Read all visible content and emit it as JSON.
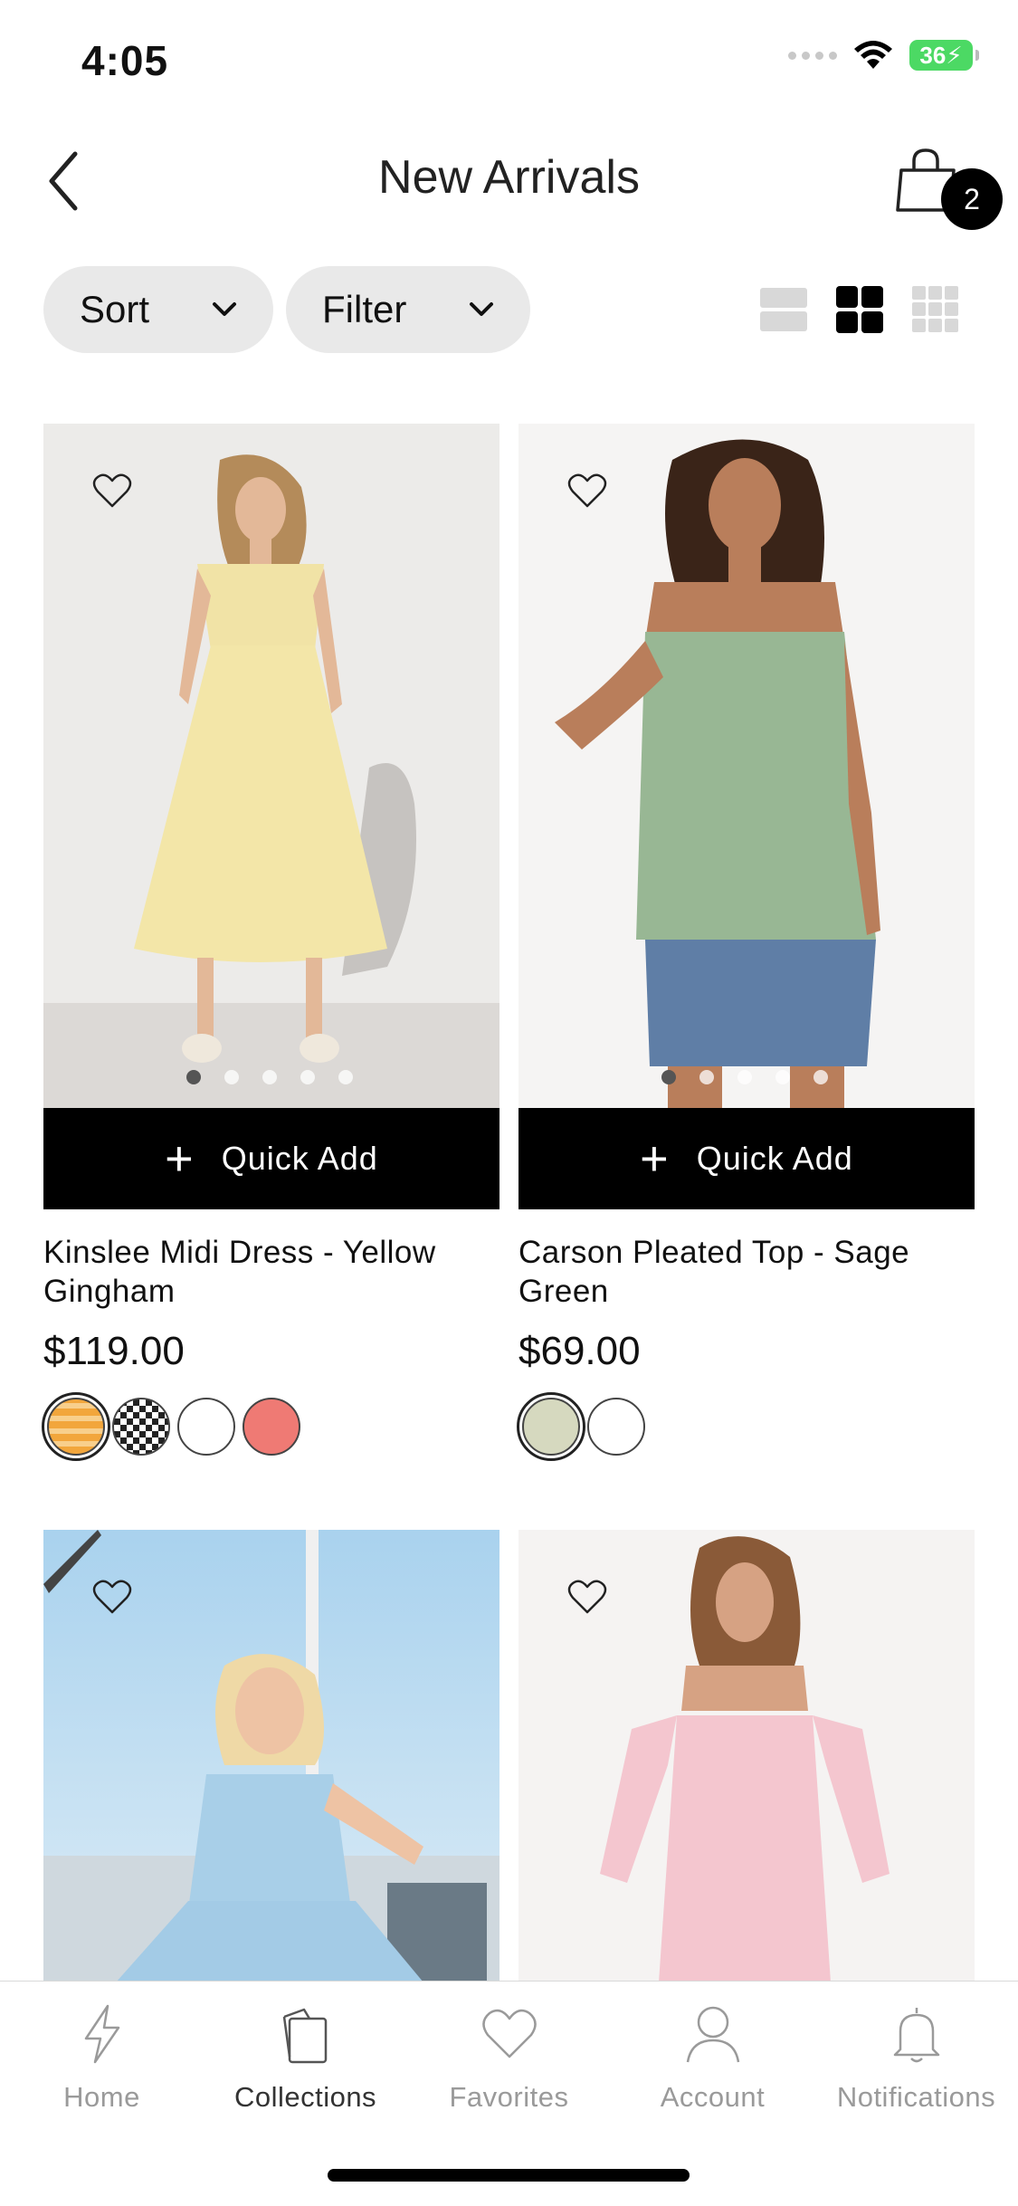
{
  "status_bar": {
    "time": "4:05",
    "battery": "36"
  },
  "header": {
    "title": "New Arrivals",
    "cart_count": "2"
  },
  "controls": {
    "sort_label": "Sort",
    "filter_label": "Filter"
  },
  "products": [
    {
      "name": "Kinslee Midi Dress - Yellow Gingham",
      "price": "$119.00",
      "quick_add": "Quick Add",
      "swatches": [
        "#f2a63c",
        "#222222",
        "#ffffff",
        "#ef7a74"
      ]
    },
    {
      "name": "Carson Pleated Top - Sage Green",
      "price": "$69.00",
      "quick_add": "Quick Add",
      "swatches": [
        "#d6d9bf",
        "#ffffff"
      ]
    }
  ],
  "tabs": [
    {
      "label": "Home",
      "icon": "bolt-icon"
    },
    {
      "label": "Collections",
      "icon": "collections-icon"
    },
    {
      "label": "Favorites",
      "icon": "heart-icon"
    },
    {
      "label": "Account",
      "icon": "person-icon"
    },
    {
      "label": "Notifications",
      "icon": "bell-icon"
    }
  ],
  "colors": {
    "accent": "#000000",
    "pill_bg": "#e9e9e9",
    "battery": "#4cd964"
  }
}
